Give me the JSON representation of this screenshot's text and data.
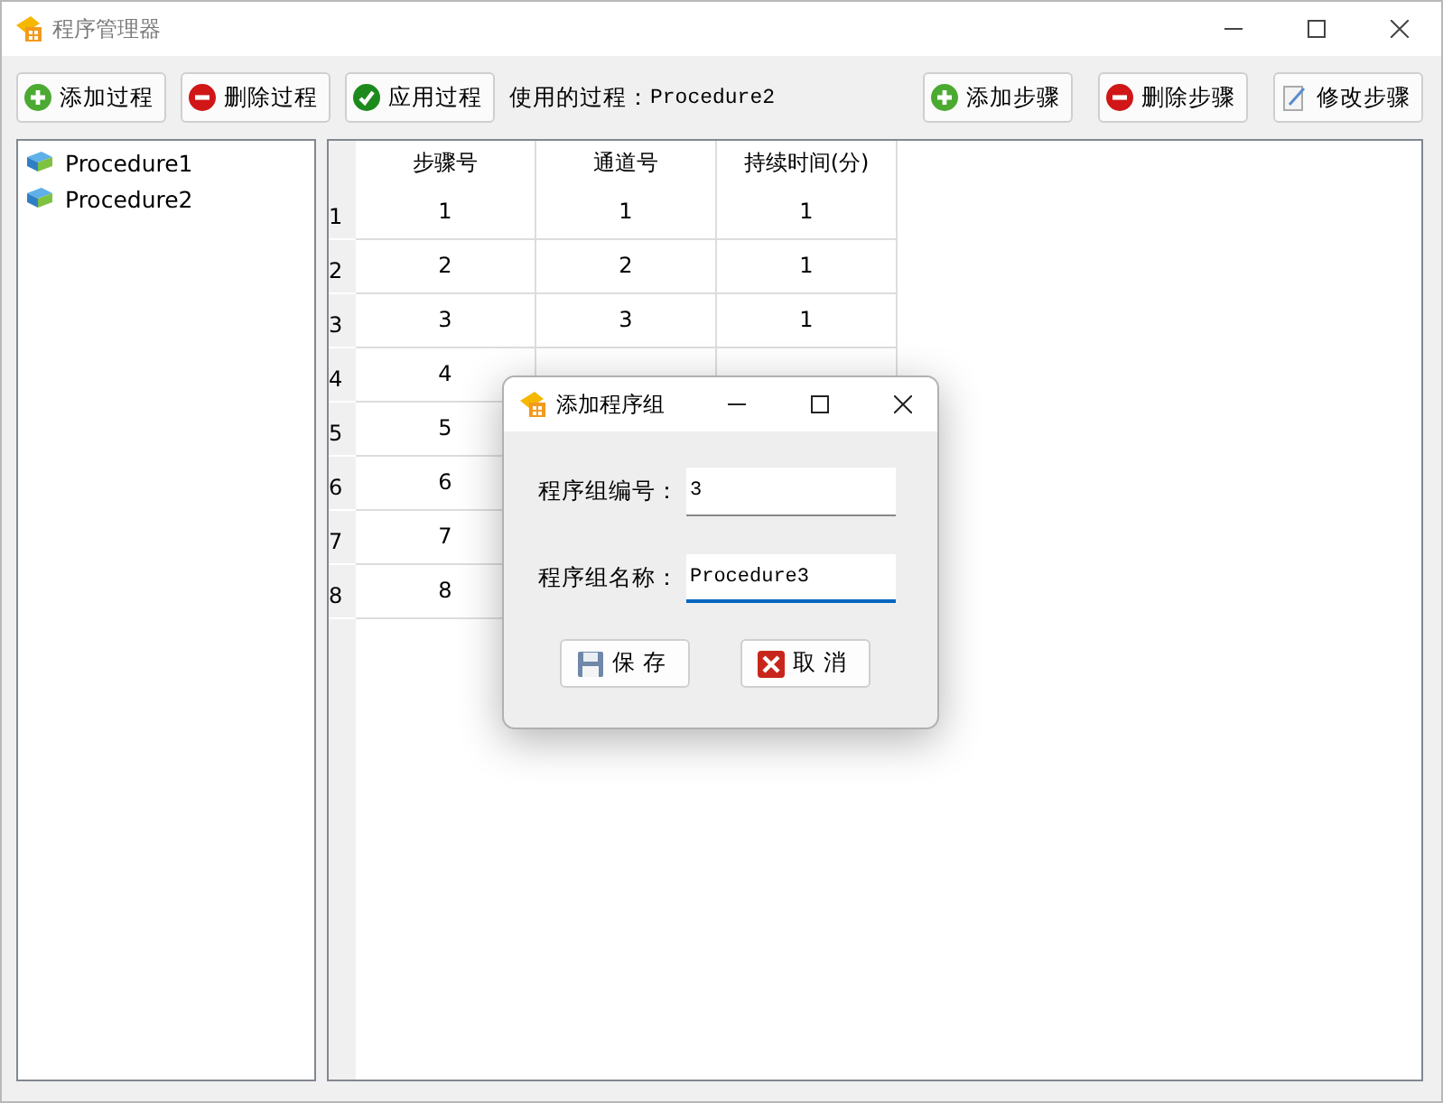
{
  "window": {
    "title": "程序管理器"
  },
  "toolbar": {
    "left_buttons": [
      {
        "kind": "add",
        "label": "添加过程"
      },
      {
        "kind": "delete",
        "label": "删除过程"
      },
      {
        "kind": "apply",
        "label": "应用过程"
      }
    ],
    "current_label": "使用的过程：",
    "current_value": "Procedure2",
    "right_buttons": [
      {
        "kind": "add",
        "label": "添加步骤"
      },
      {
        "kind": "delete",
        "label": "删除步骤"
      },
      {
        "kind": "edit",
        "label": "修改步骤"
      }
    ]
  },
  "procedures": [
    {
      "name": "Procedure1"
    },
    {
      "name": "Procedure2"
    }
  ],
  "table": {
    "columns": [
      "步骤号",
      "通道号",
      "持续时间(分)"
    ],
    "rows": [
      {
        "header": "1",
        "cells": [
          "1",
          "1",
          "1"
        ]
      },
      {
        "header": "2",
        "cells": [
          "2",
          "2",
          "1"
        ]
      },
      {
        "header": "3",
        "cells": [
          "3",
          "3",
          "1"
        ]
      },
      {
        "header": "4",
        "cells": [
          "4"
        ]
      },
      {
        "header": "5",
        "cells": [
          "5"
        ]
      },
      {
        "header": "6",
        "cells": [
          "6"
        ]
      },
      {
        "header": "7",
        "cells": [
          "7"
        ]
      },
      {
        "header": "8",
        "cells": [
          "8"
        ]
      }
    ]
  },
  "dialog": {
    "title": "添加程序组",
    "fields": [
      {
        "label": "程序组编号：",
        "value": "3",
        "selected": false
      },
      {
        "label": "程序组名称：",
        "value": "Procedure3",
        "selected": true
      }
    ],
    "buttons": [
      {
        "kind": "save",
        "label": "保 存"
      },
      {
        "kind": "cancel",
        "label": "取 消"
      }
    ]
  }
}
